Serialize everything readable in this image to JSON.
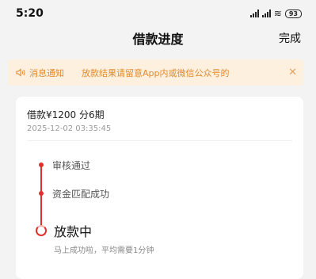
{
  "status_bar": {
    "time": "5:20",
    "battery": "93"
  },
  "nav": {
    "title": "借款进度",
    "done_label": "完成"
  },
  "notice": {
    "label": "消息通知",
    "text": "放款结果请留意App内或微信公众号的",
    "close_icon": "close-icon"
  },
  "loan": {
    "summary": "借款¥1200 分6期",
    "timestamp": "2025-12-02 03:35:45"
  },
  "progress": {
    "steps": [
      {
        "label": "审核通过",
        "status": "done"
      },
      {
        "label": "资金匹配成功",
        "status": "done"
      }
    ],
    "current": {
      "label": "放款中",
      "note": "马上成功啦，平均需要1分钟"
    }
  },
  "colors": {
    "accent": "#e0302c",
    "notice_bg": "#fdf0df",
    "notice_text": "#e48a2b"
  }
}
